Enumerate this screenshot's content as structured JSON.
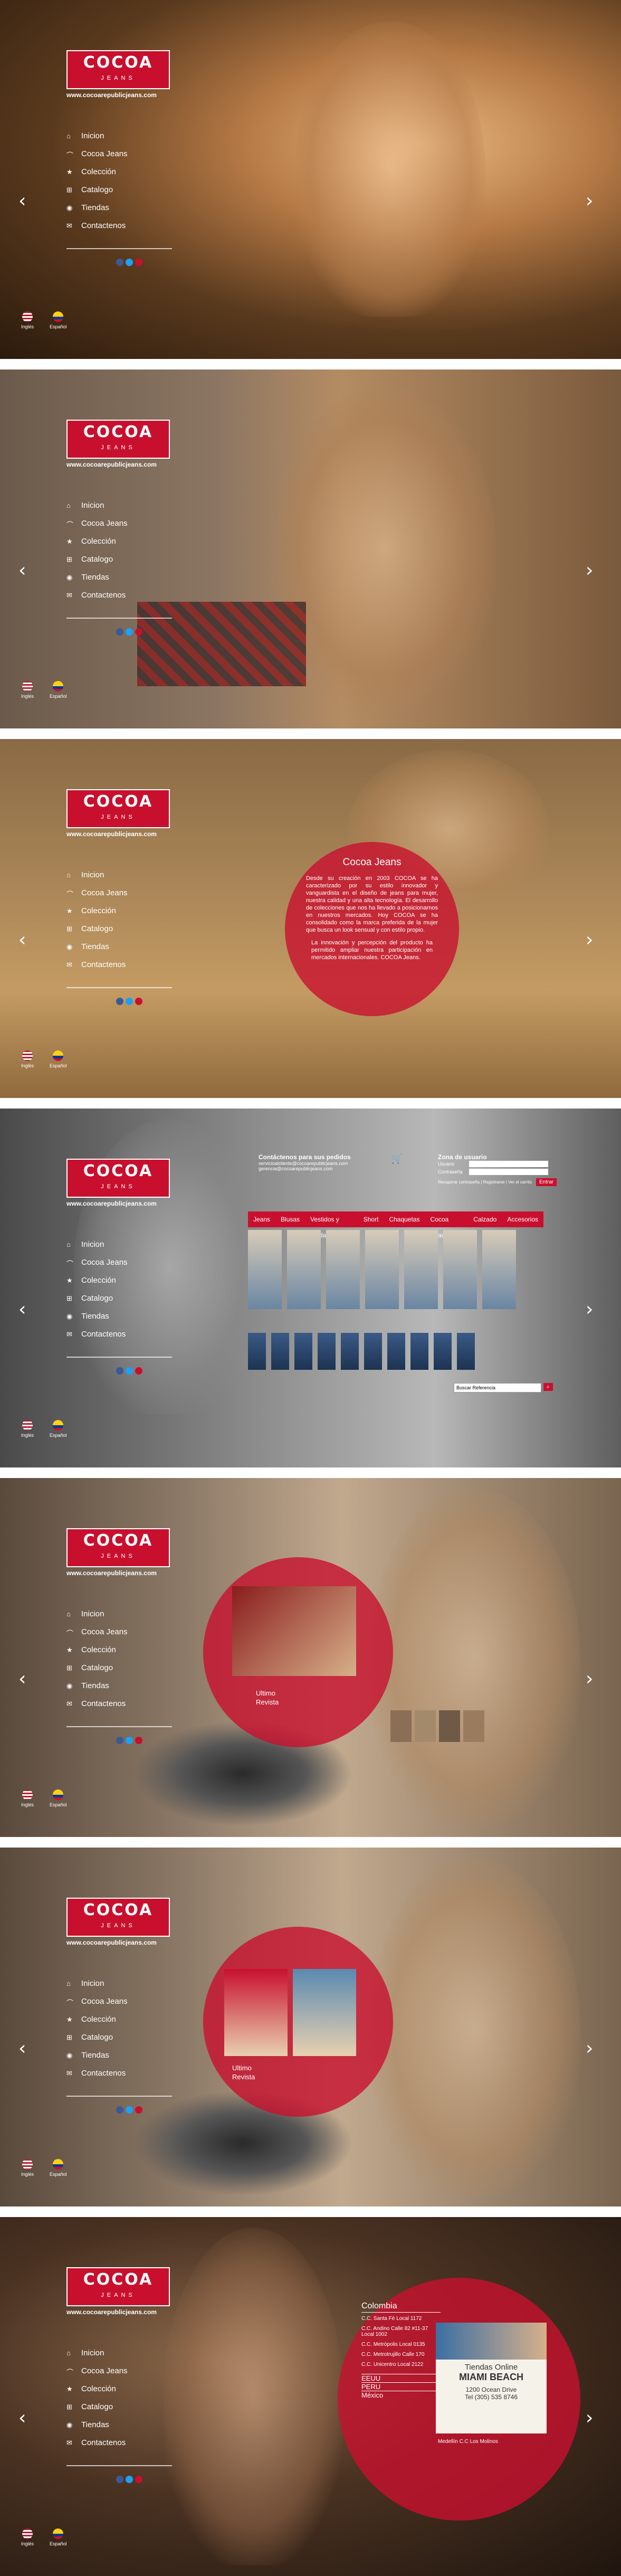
{
  "brand": {
    "name": "COCOA",
    "sub": "JEANS",
    "url": "www.cocoarepublicjeans.com"
  },
  "nav": [
    {
      "label": "Inicion",
      "icon": "home-icon"
    },
    {
      "label": "Cocoa Jeans",
      "icon": "hanger-icon"
    },
    {
      "label": "Colección",
      "icon": "star-icon"
    },
    {
      "label": "Catalogo",
      "icon": "cart-icon"
    },
    {
      "label": "Tiendas",
      "icon": "map-pin-icon"
    },
    {
      "label": "Contactenos",
      "icon": "mail-icon"
    }
  ],
  "languages": [
    {
      "label": "Inglés"
    },
    {
      "label": "Español"
    }
  ],
  "panel3": {
    "title": "Cocoa Jeans",
    "text": "Desde su creación en 2003 COCOA se ha caracterizado por su estilo innovador y vanguardista en el diseño de jeans para mujer, nuestra calidad y una alta tecnología. El desarrollo de colecciones que nos ha llevado a posicionarnos en nuestros mercados. Hoy COCOA se ha consolidado como la marca preferida de la mujer que busca un look sensual y con estilo propio.",
    "text2": "La innovación y percepción del producto ha permitido ampliar nuestra participación en mercados internacionales. COCOA Jeans."
  },
  "panel4": {
    "contact_title": "Contáctenos para sus pedidos",
    "contact_lines": [
      "servicioalcliente@cocoarepublicjeans.com",
      "gerencia@cocoarepublicjeans.com"
    ],
    "user_zone": "Zona de usuario",
    "user_label": "Usuario",
    "pass_label": "Contraseña",
    "forgot": "Recuperar contraseña  |  Registrarse  |  Ver el carrito",
    "enter": "Entrar",
    "tabs": [
      "Jeans",
      "Blusas",
      "Vestidos y Faldas",
      "Short",
      "Chaquetas",
      "Cocoa Beach",
      "Calzado",
      "Accesorios"
    ],
    "search_placeholder": "Buscar Referencia"
  },
  "panel5": {
    "circle_label1": "Ultimo",
    "circle_label2": "Revista"
  },
  "panel6": {
    "circle_label1": "Ultimo",
    "circle_label2": "Revista"
  },
  "panel7": {
    "country": "Colombia",
    "stores": [
      "C.C. Santa Fé Local 1172",
      "C.C. Andino Calle 82 #11-37 Local 1002",
      "C.C. Metrópolis Local 0135",
      "C.C. Metrotrujillo Calle 170",
      "C.C. Unicentro Local 2122"
    ],
    "countries": [
      "EEUU",
      "PERU",
      "México"
    ],
    "ad_title": "Tiendas Online",
    "ad_city": "MIAMI BEACH",
    "ad_address": "1200 Ocean Drive",
    "ad_phone": "Tel (305) 535 8746",
    "medellin": "Medellín C.C Los Molinos"
  },
  "colors": {
    "accent": "#c8102e"
  }
}
